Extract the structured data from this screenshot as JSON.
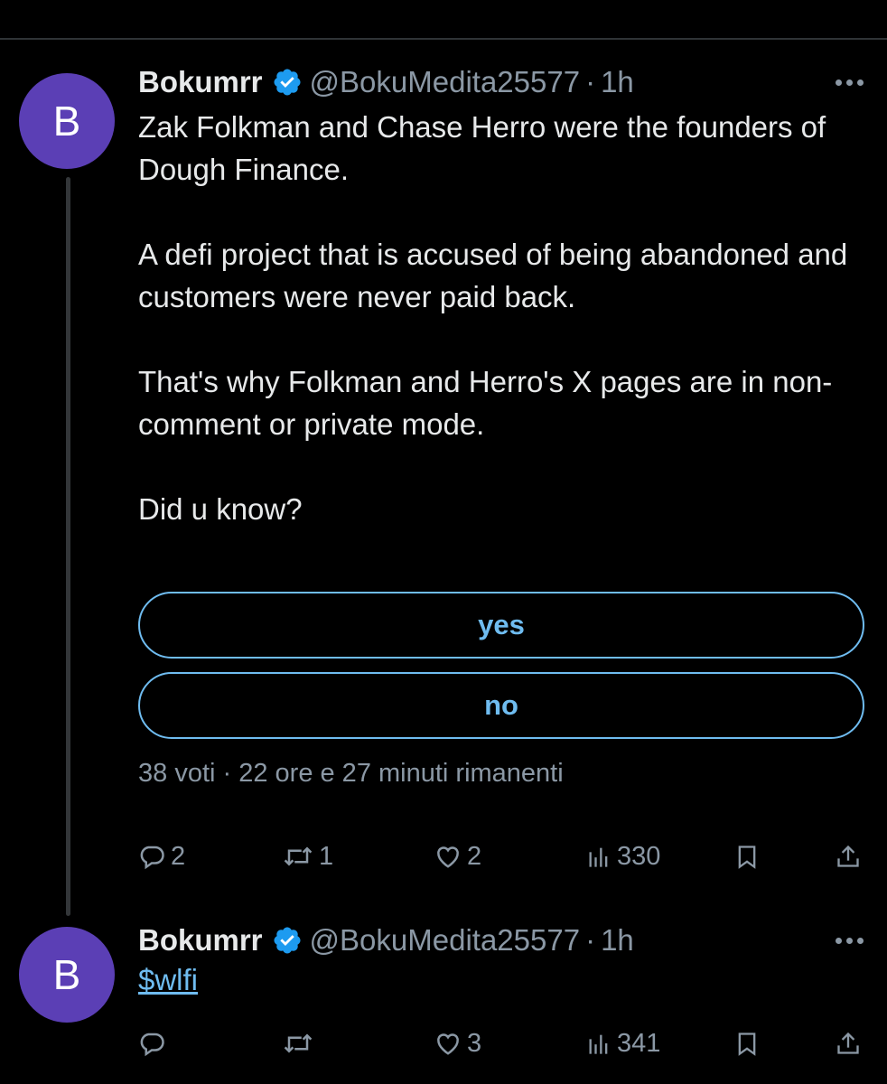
{
  "tweets": [
    {
      "avatar_letter": "B",
      "name": "Bokumrr",
      "handle": "@BokuMedita25577",
      "separator": "·",
      "time": "1h",
      "paragraphs": [
        "Zak Folkman and Chase Herro were the founders of Dough Finance.",
        "A defi project that is accused of being abandoned and customers were never paid back.",
        "That's why Folkman and Herro's X pages are in non-comment or private mode.",
        "Did u know?"
      ],
      "poll": {
        "options": [
          "yes",
          "no"
        ],
        "meta": "38 voti · 22 ore e 27 minuti rimanenti"
      },
      "stats": {
        "replies": "2",
        "reposts": "1",
        "likes": "2",
        "views": "330"
      }
    },
    {
      "avatar_letter": "B",
      "name": "Bokumrr",
      "handle": "@BokuMedita25577",
      "separator": "·",
      "time": "1h",
      "cashtag": "$wlfi",
      "stats": {
        "replies": "",
        "reposts": "",
        "likes": "3",
        "views": "341"
      }
    }
  ],
  "icons": {
    "verified": "verified-badge-icon",
    "more": "more-horizontal-icon",
    "reply": "reply-icon",
    "repost": "repost-icon",
    "like": "heart-icon",
    "views": "views-chart-icon",
    "bookmark": "bookmark-icon",
    "share": "share-icon"
  },
  "colors": {
    "accent": "#6fbcf0",
    "verified": "#1d9bf0",
    "avatar": "#5b3fb5",
    "muted": "#8b98a5"
  }
}
